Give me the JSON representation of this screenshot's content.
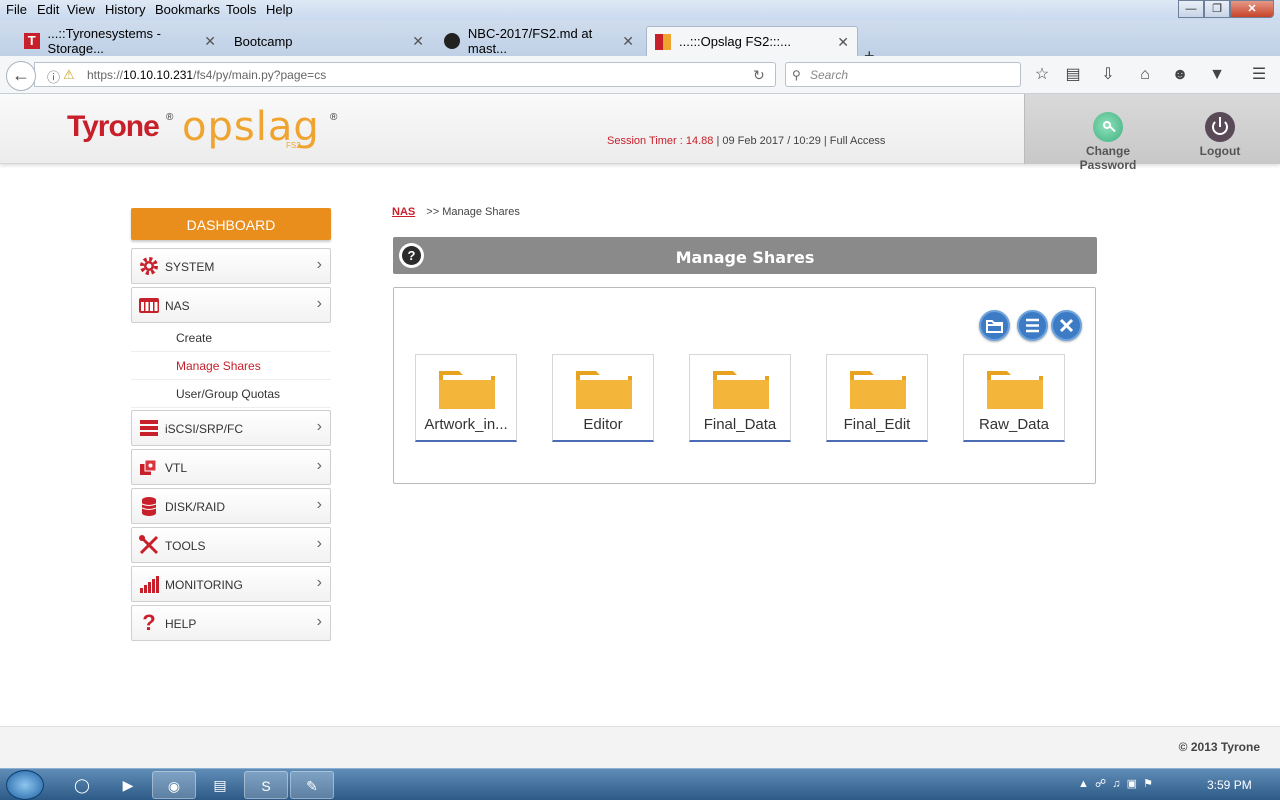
{
  "browser": {
    "menu": [
      "File",
      "Edit",
      "View",
      "History",
      "Bookmarks",
      "Tools",
      "Help"
    ],
    "tabs": [
      {
        "title": "...::Tyronesystems - Storage..."
      },
      {
        "title": "Bootcamp"
      },
      {
        "title": "NBC-2017/FS2.md at mast..."
      },
      {
        "title": "...:::Opslag FS2:::..."
      }
    ],
    "url_prefix": "https://",
    "url_host": "10.10.10.231",
    "url_path": "/fs4/py/main.py?page=cs",
    "search_placeholder": "Search"
  },
  "header": {
    "brand": "Tyrone",
    "product": "opslag",
    "product_suffix": "FS2",
    "session_label": "Session Timer : 14.88",
    "session_rest": "| 09 Feb 2017 / 10:29 | Full Access",
    "change_password": "Change Password",
    "logout": "Logout"
  },
  "sidebar": {
    "dashboard": "DASHBOARD",
    "system": "SYSTEM",
    "nas": "NAS",
    "nas_sub": {
      "create": "Create",
      "manage": "Manage Shares",
      "quotas": "User/Group Quotas"
    },
    "iscsi": "iSCSI/SRP/FC",
    "vtl": "VTL",
    "disk": "DISK/RAID",
    "tools": "TOOLS",
    "monitoring": "MONITORING",
    "help": "HELP"
  },
  "main": {
    "crumb_link": "NAS",
    "crumb_current": ">> Manage Shares",
    "title": "Manage Shares",
    "shares": [
      "Artwork_in...",
      "Editor",
      "Final_Data",
      "Final_Edit",
      "Raw_Data"
    ]
  },
  "footer": "© 2013 Tyrone",
  "taskbar": {
    "clock": "3:59 PM"
  },
  "colors": {
    "accent": "#e98e1c",
    "brand_red": "#c8202b",
    "action_blue": "#3d7cc5",
    "folder": "#f3b63a"
  }
}
